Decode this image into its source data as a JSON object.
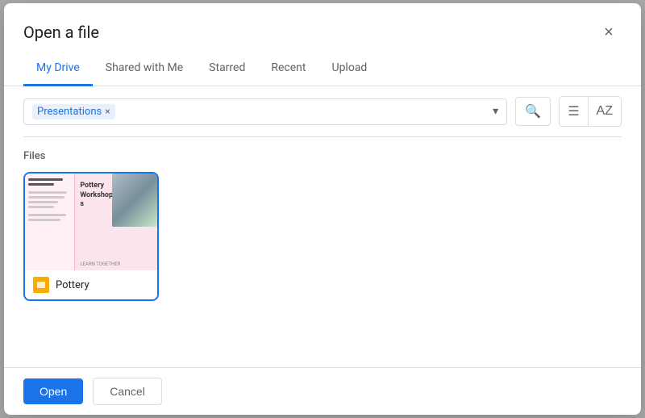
{
  "dialog": {
    "title": "Open a file",
    "close_label": "×"
  },
  "tabs": [
    {
      "id": "my-drive",
      "label": "My Drive",
      "active": true
    },
    {
      "id": "shared",
      "label": "Shared with Me",
      "active": false
    },
    {
      "id": "starred",
      "label": "Starred",
      "active": false
    },
    {
      "id": "recent",
      "label": "Recent",
      "active": false
    },
    {
      "id": "upload",
      "label": "Upload",
      "active": false
    }
  ],
  "filter": {
    "tag": "Presentations",
    "tag_close": "×",
    "chevron": "▾"
  },
  "toolbar": {
    "search_icon": "🔍",
    "list_icon": "☰",
    "sort_icon": "AZ"
  },
  "section": {
    "files_label": "Files"
  },
  "files": [
    {
      "id": "pottery",
      "name": "Pottery",
      "thumb_title": "Pottery Workshops",
      "thumb_subtitle": "LEARN TOGETHER"
    }
  ],
  "footer": {
    "open_label": "Open",
    "cancel_label": "Cancel"
  }
}
